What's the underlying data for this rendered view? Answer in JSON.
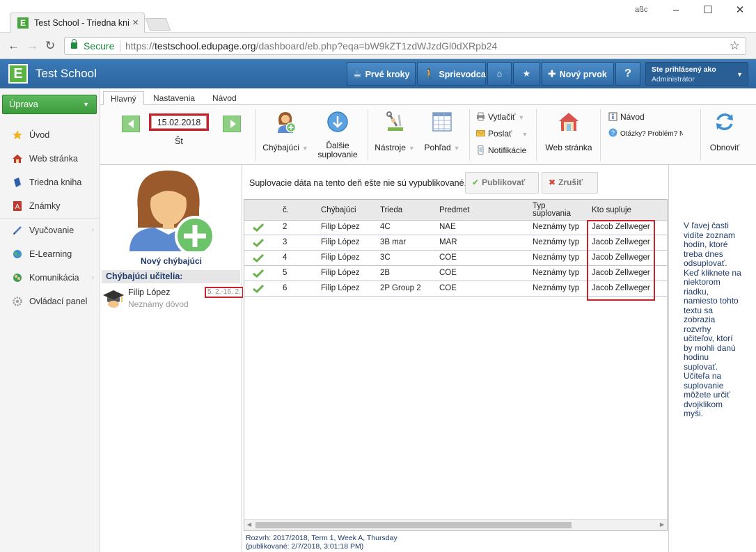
{
  "browser": {
    "tab_title": "Test School - Triedna kni",
    "window_user": "aßc",
    "secure_label": "Secure",
    "url_scheme": "https://",
    "url_host": "testschool.edupage.org",
    "url_path": "/dashboard/eb.php?eqa=bW9kZT1zdWJzdGl0dXRpb24"
  },
  "app": {
    "logo_letter": "E",
    "title": "Test School",
    "top_buttons": {
      "first_steps": "Prvé kroky",
      "guide": "Sprievodca",
      "new_item": "Nový prvok",
      "help": "?"
    },
    "user": {
      "line1": "Ste prihlásený ako",
      "line2": "Administrátor"
    }
  },
  "sidebar": {
    "mode_button": "Úprava",
    "items": [
      {
        "label": "Úvod"
      },
      {
        "label": "Web stránka"
      },
      {
        "label": "Triedna kniha"
      },
      {
        "label": "Známky"
      },
      {
        "label": "Vyučovanie"
      },
      {
        "label": "E-Learning"
      },
      {
        "label": "Komunikácia"
      },
      {
        "label": "Ovládací panel"
      }
    ]
  },
  "ribbon": {
    "tabs": [
      "Hlavný",
      "Nastavenia",
      "Návod"
    ],
    "date_value": "15.02.2018",
    "day_label": "Št",
    "absent_btn": "Chýbajúci",
    "next_sub_line1": "Ďalšie",
    "next_sub_line2": "suplovanie",
    "tools_btn": "Nástroje",
    "view_btn": "Pohľad",
    "print_btn": "Vytlačiť",
    "send_btn": "Poslať",
    "notif_btn": "Notifikácie",
    "web_btn": "Web stránka",
    "guide_btn": "Návod",
    "questions_btn": "Otázky? Problém? N",
    "refresh_btn": "Obnoviť"
  },
  "absent_panel": {
    "new_absent": "Nový chýbajúci",
    "header": "Chýbajúci učitelia:",
    "teacher_name": "Filip López",
    "teacher_reason": "Neznámy dôvod",
    "teacher_hours": "5. 2.-16. 2."
  },
  "main": {
    "notice": "Suplovacie dáta na tento deň ešte nie sú vypublikované.",
    "publish_btn": "Publikovať",
    "cancel_btn": "Zrušiť",
    "columns": {
      "num": "č.",
      "absent": "Chýbajúci",
      "class": "Trieda",
      "subject": "Predmet",
      "type_line1": "Typ",
      "type_line2": "suplovania",
      "who": "Kto supluje"
    },
    "rows": [
      {
        "num": "2",
        "absent": "Filip López",
        "class": "4C",
        "subject": "NAE",
        "type": "Neznámy typ",
        "who": "Jacob Zellweger"
      },
      {
        "num": "3",
        "absent": "Filip López",
        "class": "3B mar",
        "subject": "MAR",
        "type": "Neznámy typ",
        "who": "Jacob Zellweger"
      },
      {
        "num": "4",
        "absent": "Filip López",
        "class": "3C",
        "subject": "COE",
        "type": "Neznámy typ",
        "who": "Jacob Zellweger"
      },
      {
        "num": "5",
        "absent": "Filip López",
        "class": "2B",
        "subject": "COE",
        "type": "Neznámy typ",
        "who": "Jacob Zellweger"
      },
      {
        "num": "6",
        "absent": "Filip López",
        "class": "2P Group 2",
        "subject": "COE",
        "type": "Neznámy typ",
        "who": "Jacob Zellweger"
      }
    ],
    "footer_line1": "Rozvrh: 2017/2018, Term 1, Week A, Thursday",
    "footer_line2": "(publikované: 2/7/2018, 3:01:18 PM)"
  },
  "help_text": "V ľavej časti vidíte zoznam hodín, ktoré treba dnes odsuplovať. Keď kliknete na niektorom riadku, namiesto tohto textu sa zobrazia rozvrhy učiteľov, ktorí by mohli danú hodinu suplovať. Učiteľa na suplovanie môžete určiť dvojklikom myši.",
  "colors": {
    "appbar": "#2c65a0",
    "mode_green": "#4cae4c",
    "highlight_red": "#c8232c",
    "link_navy": "#1f3a6b"
  }
}
